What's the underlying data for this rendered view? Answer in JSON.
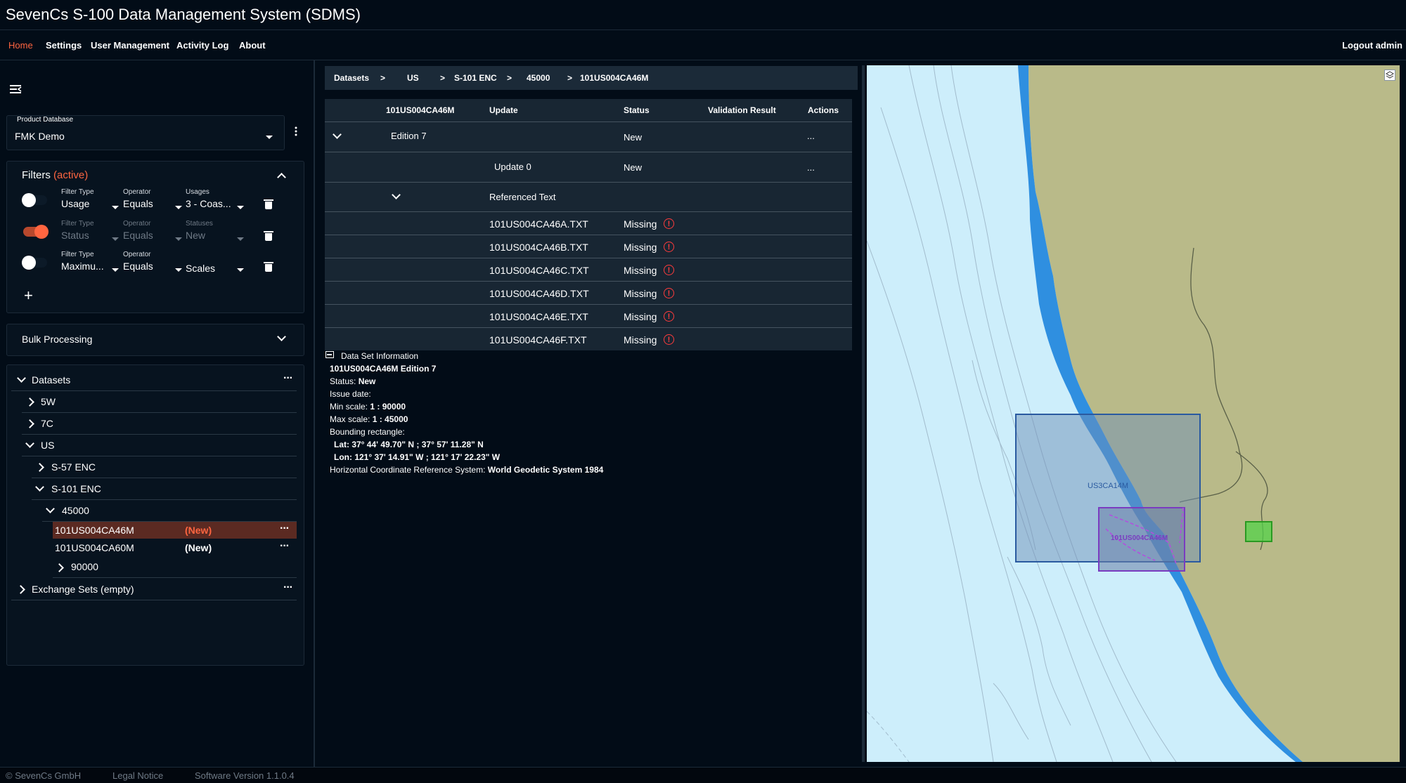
{
  "app": {
    "title": "SevenCs S-100 Data Management System (SDMS)"
  },
  "nav": {
    "items": [
      {
        "label": "Home",
        "active": true
      },
      {
        "label": "Settings"
      },
      {
        "label": "User Management"
      },
      {
        "label": "Activity Log"
      },
      {
        "label": "About"
      }
    ],
    "logout": "Logout admin"
  },
  "sidebar": {
    "collapse_icon": "sidebar-collapse-icon",
    "product_db": {
      "label": "Product Database",
      "value": "FMK Demo"
    },
    "filters": {
      "title": "Filters",
      "active_tag": "(active)",
      "accent_color": "#ff6540",
      "rows": [
        {
          "enabled": false,
          "type_label": "Filter Type",
          "type": "Usage",
          "op_label": "Operator",
          "op": "Equals",
          "val_label": "Usages",
          "val": "3 - Coas..."
        },
        {
          "enabled": true,
          "type_label": "Filter Type",
          "type": "Status",
          "op_label": "Operator",
          "op": "Equals",
          "val_label": "Statuses",
          "val": "New"
        },
        {
          "enabled": false,
          "type_label": "Filter Type",
          "type": "Maximu...",
          "op_label": "Operator",
          "op": "Equals",
          "val_label": "",
          "val": "Scales"
        }
      ],
      "add": "+"
    },
    "bulk": {
      "label": "Bulk Processing"
    },
    "tree": {
      "datasets": "Datasets",
      "n5w": "5W",
      "n7c": "7C",
      "us": "US",
      "s57": "S-57 ENC",
      "s101": "S-101 ENC",
      "s45000": "45000",
      "ds1": {
        "label": "101US004CA46M",
        "status": "(New)"
      },
      "ds2": {
        "label": "101US004CA60M",
        "status": "(New)"
      },
      "s90000": "90000",
      "exchange": "Exchange Sets (empty)",
      "dots": "···"
    }
  },
  "breadcrumb": {
    "items": [
      "Datasets",
      "US",
      "S-101 ENC",
      "45000",
      "101US004CA46M"
    ],
    "sep": ">"
  },
  "table": {
    "headers": {
      "name": "101US004CA46M",
      "update": "Update",
      "status": "Status",
      "validation": "Validation Result",
      "actions": "Actions"
    },
    "edition": {
      "label": "Edition 7",
      "status": "New",
      "actions": "..."
    },
    "update0": {
      "label": "Update 0",
      "status": "New",
      "actions": "..."
    },
    "ref_text": "Referenced Text",
    "files": [
      {
        "name": "101US004CA46A.TXT",
        "status": "Missing"
      },
      {
        "name": "101US004CA46B.TXT",
        "status": "Missing"
      },
      {
        "name": "101US004CA46C.TXT",
        "status": "Missing"
      },
      {
        "name": "101US004CA46D.TXT",
        "status": "Missing"
      },
      {
        "name": "101US004CA46E.TXT",
        "status": "Missing"
      },
      {
        "name": "101US004CA46F.TXT",
        "status": "Missing"
      }
    ],
    "warn_glyph": "!",
    "warn_color": "#ff3c3c"
  },
  "info": {
    "header": "Data Set Information",
    "title_name": "101US004CA46M",
    "title_edition": "Edition 7",
    "status_label": "Status:",
    "status": "New",
    "issue_label": "Issue date:",
    "min_label": "Min scale:",
    "min": "1 : 90000",
    "max_label": "Max scale:",
    "max": "1 : 45000",
    "bbox_label": "Bounding rectangle:",
    "lat": "Lat: 37° 44' 49.70\" N ; 37° 57' 11.28\" N",
    "lon": "Lon: 121° 37' 14.91\" W ; 121° 17' 22.23\" W",
    "crs_label": "Horizontal Coordinate Reference System:",
    "crs": "World Geodetic System 1984"
  },
  "map": {
    "label_large": "US3CA14M",
    "label_small": "101US004CA46M",
    "layers_icon": "layers-icon",
    "colors": {
      "water": "#cdeefb",
      "land": "#b9ba89",
      "deep": "#2f8fe0"
    }
  },
  "footer": {
    "copyright": "© SevenCs GmbH",
    "legal": "Legal Notice",
    "version": "Software Version 1.1.0.4"
  }
}
